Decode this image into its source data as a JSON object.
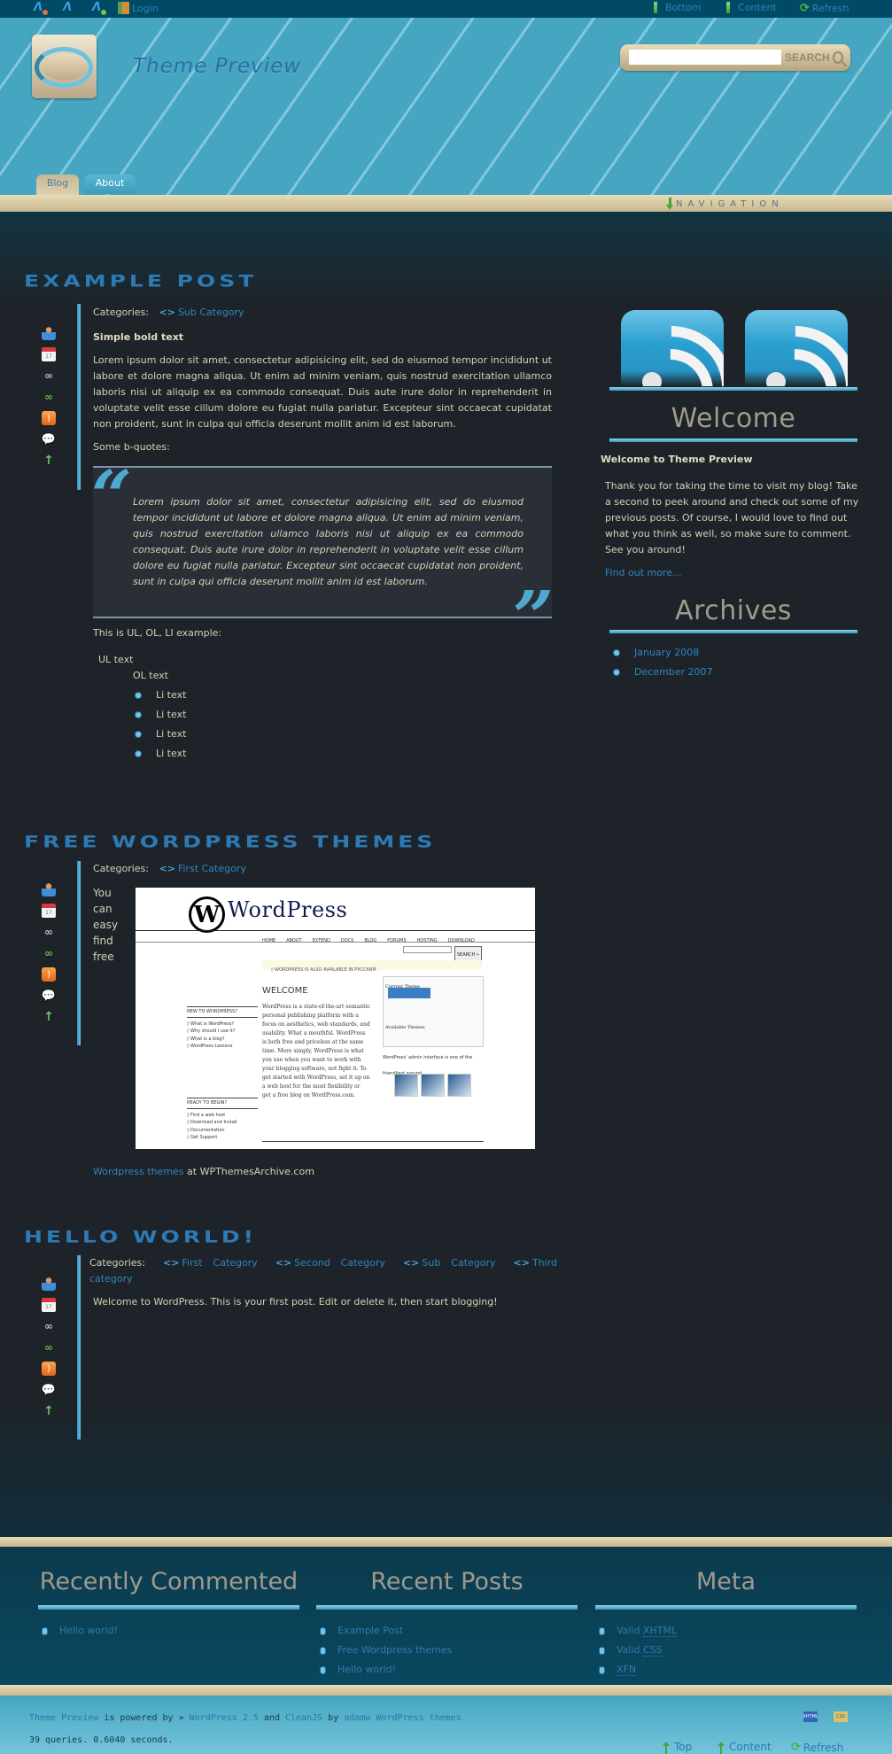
{
  "topbar": {
    "left_items": [
      {
        "icon": "author-remove-icon",
        "label": ""
      },
      {
        "icon": "author-icon",
        "label": ""
      },
      {
        "icon": "author-add-icon",
        "label": ""
      },
      {
        "icon": "login-door-icon",
        "label": "Login"
      }
    ],
    "right_items": [
      {
        "icon": "arrow-down-icon",
        "label": "Bottom"
      },
      {
        "icon": "arrow-down-icon",
        "label": "Content"
      },
      {
        "icon": "refresh-icon",
        "label": "Refresh"
      }
    ]
  },
  "header": {
    "site_title": "Theme Preview",
    "search": {
      "placeholder": "",
      "value": "",
      "button_label": "SEARCH"
    },
    "tabs": [
      {
        "label": "Blog",
        "active": true
      },
      {
        "label": "About",
        "active": false
      }
    ],
    "nav_label": "NAVIGATION"
  },
  "post_icons": [
    "author-icon",
    "calendar-icon",
    "permalink-icon",
    "trackback-icon",
    "rss-icon",
    "comment-icon",
    "top-arrow-icon"
  ],
  "calendar_day": "17",
  "posts": [
    {
      "title": "Example Post",
      "categories_label": "Categories:",
      "categories": [
        "Sub Category"
      ],
      "bold_heading": "Simple bold text",
      "paragraph": "Lorem ipsum dolor sit amet, consectetur adipisicing elit, sed do eiusmod tempor incididunt ut labore et dolore magna aliqua. Ut enim ad minim veniam, quis nostrud exercitation ullamco laboris nisi ut aliquip ex ea commodo consequat. Duis aute irure dolor in reprehenderit in voluptate velit esse cillum dolore eu fugiat nulla pariatur. Excepteur sint occaecat cupidatat non proident, sunt in culpa qui officia deserunt mollit anim id est laborum.",
      "bquote_intro": "Some b-quotes:",
      "blockquote": "Lorem ipsum dolor sit amet, consectetur adipisicing elit, sed do eiusmod tempor incididunt ut labore et dolore magna aliqua. Ut enim ad minim veniam, quis nostrud exercitation ullamco laboris nisi ut aliquip ex ea commodo consequat. Duis aute irure dolor in reprehenderit in voluptate velit esse cillum dolore eu fugiat nulla pariatur. Excepteur sint occaecat cupidatat non proident, sunt in culpa qui officia deserunt mollit anim id est laborum.",
      "list_intro": "This is UL, OL, LI example:",
      "ul_text": "UL text",
      "ol_text": "OL text",
      "li_items": [
        "Li text",
        "Li text",
        "Li text",
        "Li text"
      ]
    },
    {
      "title": "Free Wordpress Themes",
      "categories_label": "Categories:",
      "categories": [
        "First Category"
      ],
      "side_words": [
        "You",
        "can",
        "easy",
        "find",
        "free"
      ],
      "screenshot": {
        "brand": "WordPress",
        "nav": [
          "HOME",
          "ABOUT",
          "EXTEND",
          "DOCS",
          "BLOG",
          "FORUMS",
          "HOSTING",
          "DOWNLOAD"
        ],
        "search_button": "SEARCH »",
        "notice": "◊ WORDPRESS IS ALSO AVAILABLE IN РУССКИЙ.",
        "welcome": "WELCOME",
        "text": "WordPress is a state-of-the-art semantic personal publishing platform with a focus on aesthetics, web standards, and usability. What a mouthful. WordPress is both free and priceless at the same time. More simply, WordPress is what you use when you want to work with your blogging software, not fight it. To get started with WordPress, set it up on a web host for the most flexibility or get a free blog on WordPress.com.",
        "new_heading": "NEW TO WORDPRESS?",
        "new_links": [
          "◊ What is WordPress?",
          "◊ Why should I use it?",
          "◊ What is a blog?",
          "◊ WordPress Lessons"
        ],
        "ready_heading": "READY TO BEGIN?",
        "ready_links": [
          "◊ Find a web host",
          "◊ Download and Install",
          "◊ Documentation",
          "◊ Get Support"
        ],
        "theme_box_title": "Current Theme",
        "available_themes": "Available Themes",
        "caption": "WordPress' admin interface is one of the friendliest around."
      },
      "credit_link": "Wordpress themes",
      "credit_rest": " at WPThemesArchive.com"
    },
    {
      "title": "Hello world!",
      "categories_label": "Categories:",
      "categories": [
        "First Category",
        "Second Category",
        "Sub Category",
        "Third category"
      ],
      "paragraph": "Welcome to WordPress. This is your first post. Edit or delete it, then start blogging!"
    }
  ],
  "sidebar": {
    "feed_icons": [
      "rss-posts-icon",
      "rss-comments-icon"
    ],
    "welcome_title": "Welcome",
    "welcome_subtitle": "Welcome to Theme Preview",
    "welcome_text": "Thank you for taking the time to visit my blog! Take a second to peek around and check out some of my previous posts. Of course, I would love to find out what you think as well, so make sure to comment. See you around!",
    "find_more": "Find out more...",
    "archives_title": "Archives",
    "archives": [
      "January 2008",
      "December 2007"
    ]
  },
  "footer_widgets": [
    {
      "title": "Recently Commented",
      "items": [
        "Hello world!"
      ]
    },
    {
      "title": "Recent Posts",
      "items": [
        "Example Post",
        "Free Wordpress themes",
        "Hello world!"
      ]
    },
    {
      "title": "Meta",
      "items": [
        {
          "prefix": "Valid ",
          "abbr": "XHTML"
        },
        {
          "prefix": "Valid ",
          "abbr": "CSS"
        },
        {
          "prefix": "",
          "abbr": "XFN"
        }
      ]
    }
  ],
  "footer": {
    "site_link": "Theme Preview",
    "powered_text": " is powered by » ",
    "wp_link": "WordPress 2.5",
    "and_text": " and ",
    "theme_link": "CleanJS",
    "by_text": " by ",
    "author_link": "adamw WordPress themes",
    "queries": "39 queries. 0.6040 seconds.",
    "badges": [
      "XHTML",
      "CSS"
    ],
    "nav": [
      {
        "icon": "arrow-up-icon",
        "label": "Top"
      },
      {
        "icon": "arrow-up-icon",
        "label": "Content"
      },
      {
        "icon": "refresh-icon",
        "label": "Refresh"
      }
    ]
  },
  "colors": {
    "header_blue": "#46a5c0",
    "topbar": "#004a66",
    "beige_bar": "#e6dcb6",
    "body_bg": "#1d2328",
    "link": "#2f86c3",
    "post_title": "#2e7ab5",
    "widget_title": "#a09a8b"
  }
}
